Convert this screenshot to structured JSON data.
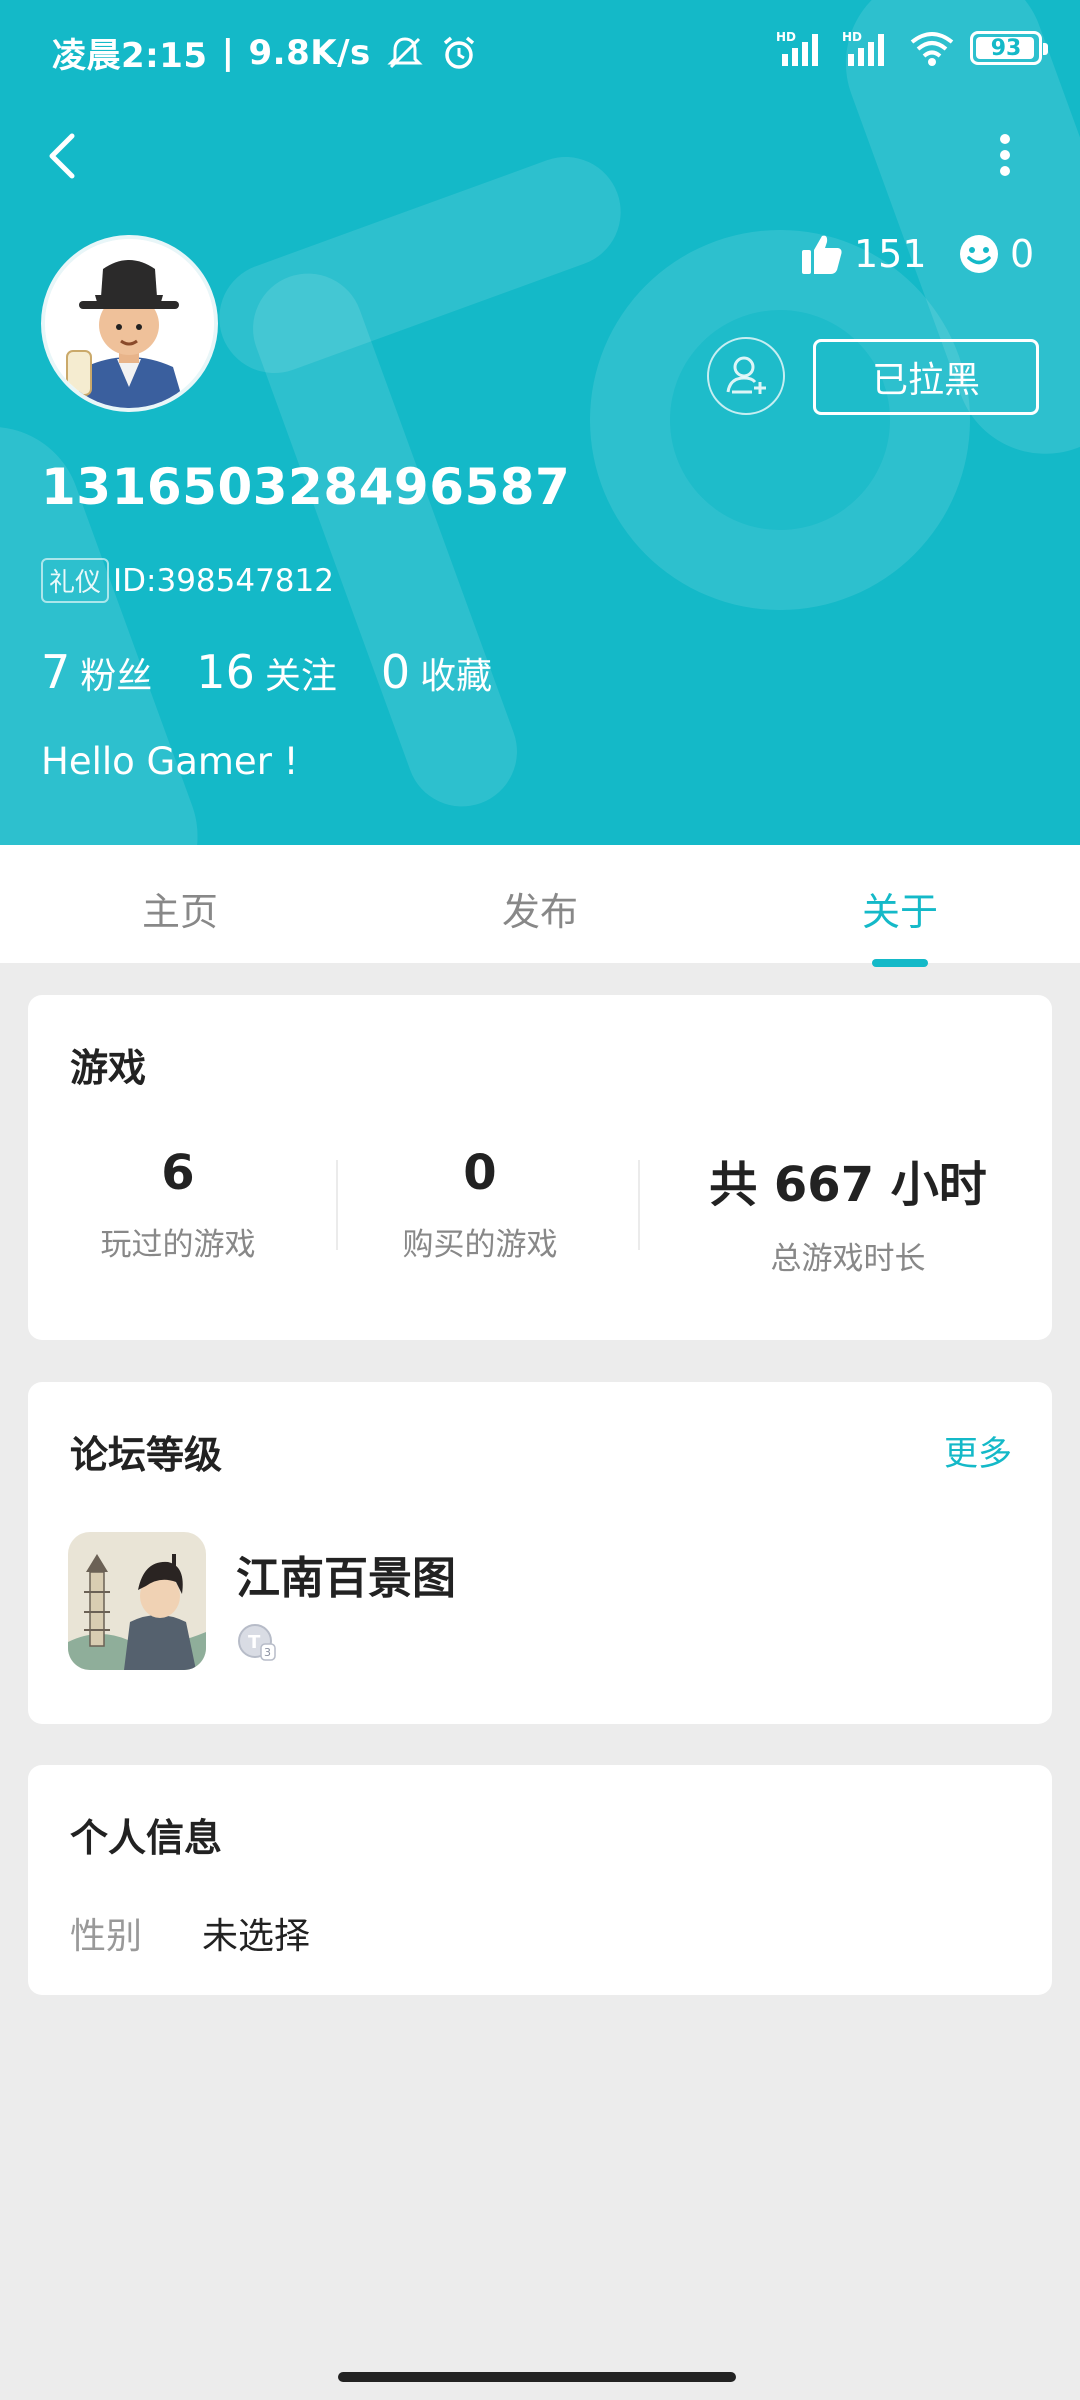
{
  "status_bar": {
    "time": "凌晨2:15",
    "net_speed": "9.8K/s",
    "battery": "93",
    "hd1": "HD",
    "hd2": "HD"
  },
  "profile": {
    "username": "131650328496587",
    "tag": "礼仪",
    "id_text": "ID:398547812",
    "likes": "151",
    "smiles": "0",
    "blocked_label": "已拉黑",
    "fans_count": "7",
    "fans_label": "粉丝",
    "following_count": "16",
    "following_label": "关注",
    "favorites_count": "0",
    "favorites_label": "收藏",
    "bio": "Hello Gamer !"
  },
  "tabs": [
    {
      "label": "主页",
      "active": false
    },
    {
      "label": "发布",
      "active": false
    },
    {
      "label": "关于",
      "active": true
    }
  ],
  "games": {
    "title": "游戏",
    "stats": [
      {
        "value": "6",
        "label": "玩过的游戏"
      },
      {
        "value": "0",
        "label": "购买的游戏"
      },
      {
        "value": "共 667 小时",
        "label": "总游戏时长"
      }
    ]
  },
  "forum": {
    "title": "论坛等级",
    "more": "更多",
    "game_name": "江南百景图",
    "level_badge": "T3"
  },
  "personal_info": {
    "title": "个人信息",
    "gender_key": "性别",
    "gender_value": "未选择"
  },
  "colors": {
    "accent": "#14b9c8",
    "background": "#ececec"
  }
}
